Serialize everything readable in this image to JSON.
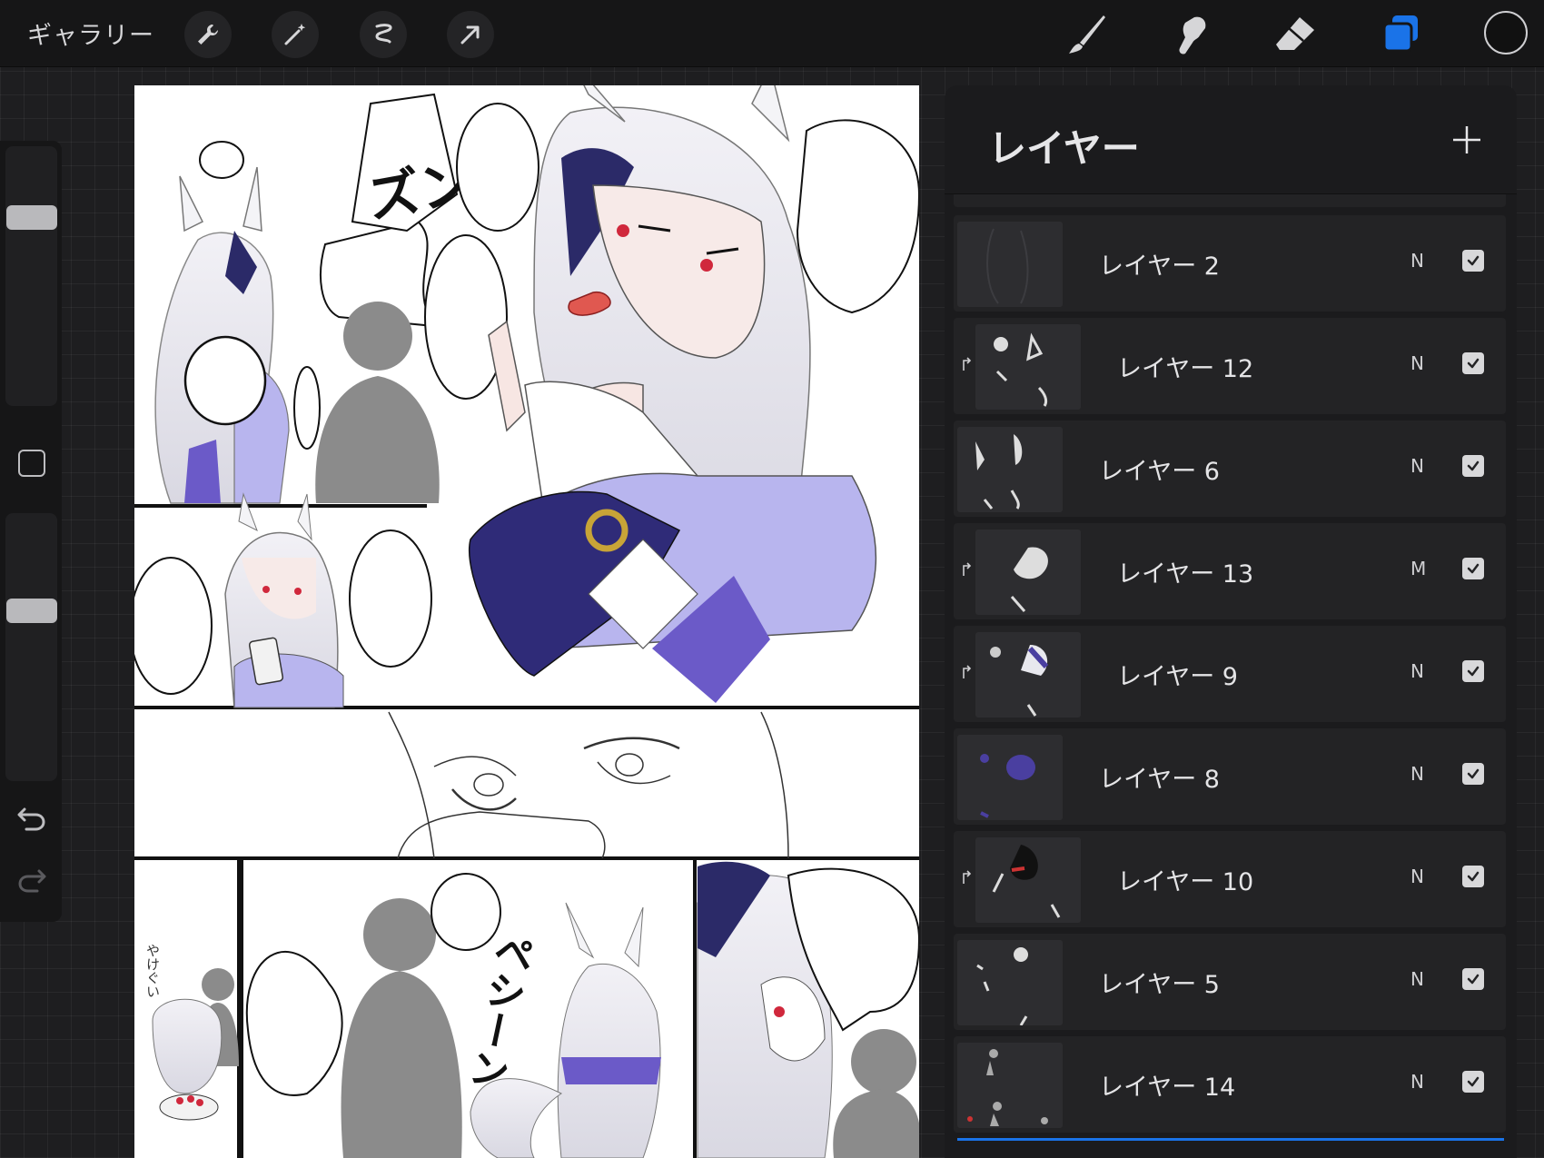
{
  "toolbar": {
    "gallery_label": "ギャラリー",
    "left_tools": [
      "wrench-icon",
      "magic-wand-icon",
      "selection-icon",
      "transform-arrow-icon"
    ],
    "right_tools": [
      "brush-icon",
      "smudge-icon",
      "eraser-icon",
      "layers-icon"
    ],
    "active_tool": "layers-icon",
    "active_color": "#1a73e8",
    "current_color": "#111111"
  },
  "sidebar": {
    "brush_size_level": 0.75,
    "opacity_level": 0.65,
    "icons": [
      "modifier-square-icon",
      "undo-icon",
      "redo-icon"
    ]
  },
  "layers_panel": {
    "title": "レイヤー",
    "add_icon": "plus-icon",
    "layers": [
      {
        "name": "レイヤー 2",
        "blend": "N",
        "visible": true,
        "clipped": false
      },
      {
        "name": "レイヤー 12",
        "blend": "N",
        "visible": true,
        "clipped": true
      },
      {
        "name": "レイヤー 6",
        "blend": "N",
        "visible": true,
        "clipped": false
      },
      {
        "name": "レイヤー 13",
        "blend": "M",
        "visible": true,
        "clipped": true
      },
      {
        "name": "レイヤー 9",
        "blend": "N",
        "visible": true,
        "clipped": true
      },
      {
        "name": "レイヤー 8",
        "blend": "N",
        "visible": true,
        "clipped": false
      },
      {
        "name": "レイヤー 10",
        "blend": "N",
        "visible": true,
        "clipped": true
      },
      {
        "name": "レイヤー 5",
        "blend": "N",
        "visible": true,
        "clipped": false
      },
      {
        "name": "レイヤー 14",
        "blend": "N",
        "visible": true,
        "clipped": false
      }
    ]
  },
  "canvas": {
    "sfx": [
      "ズンっ",
      "ペシーン",
      "やけぐい"
    ]
  }
}
